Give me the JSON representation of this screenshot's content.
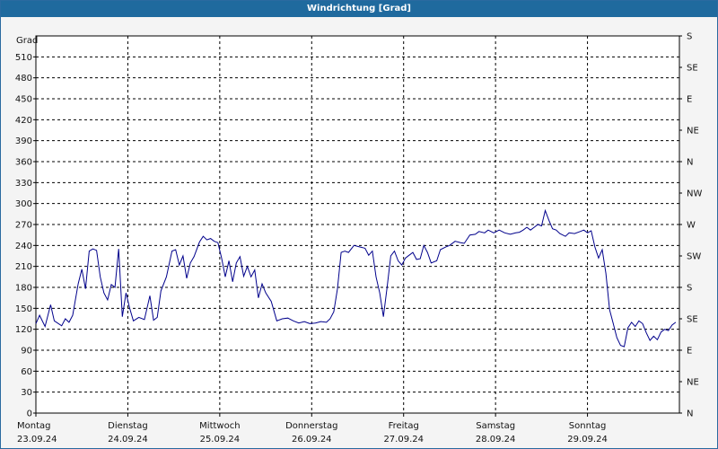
{
  "title": "Windrichtung [Grad]",
  "chart_data": {
    "type": "line",
    "title": "Windrichtung [Grad]",
    "ylabel": "Grad",
    "ylim": [
      0,
      540
    ],
    "yticks": [
      0,
      30,
      60,
      90,
      120,
      150,
      180,
      210,
      240,
      270,
      300,
      330,
      360,
      390,
      420,
      450,
      480,
      510
    ],
    "right_axis_labels": [
      "N",
      "NE",
      "E",
      "SE",
      "S",
      "SW",
      "W",
      "NW",
      "N",
      "NE",
      "E",
      "SE",
      "S"
    ],
    "right_axis_values": [
      0,
      45,
      90,
      135,
      180,
      225,
      270,
      315,
      360,
      405,
      450,
      495,
      540
    ],
    "days": [
      {
        "name": "Montag",
        "date": "23.09.24"
      },
      {
        "name": "Dienstag",
        "date": "24.09.24"
      },
      {
        "name": "Mittwoch",
        "date": "25.09.24"
      },
      {
        "name": "Donnerstag",
        "date": "26.09.24"
      },
      {
        "name": "Freitag",
        "date": "27.09.24"
      },
      {
        "name": "Samstag",
        "date": "28.09.24"
      },
      {
        "name": "Sonntag",
        "date": "29.09.24"
      }
    ],
    "x_unit": "days since Montag 23.09.24 00:00",
    "xlim": [
      0,
      7
    ],
    "grid": true,
    "line_color": "#00008b",
    "series": [
      {
        "name": "Windrichtung",
        "points": [
          [
            0.0,
            128
          ],
          [
            0.04,
            140
          ],
          [
            0.1,
            124
          ],
          [
            0.16,
            155
          ],
          [
            0.2,
            132
          ],
          [
            0.28,
            125
          ],
          [
            0.32,
            135
          ],
          [
            0.36,
            130
          ],
          [
            0.4,
            140
          ],
          [
            0.46,
            185
          ],
          [
            0.5,
            206
          ],
          [
            0.54,
            178
          ],
          [
            0.58,
            232
          ],
          [
            0.62,
            235
          ],
          [
            0.66,
            233
          ],
          [
            0.7,
            195
          ],
          [
            0.74,
            172
          ],
          [
            0.78,
            162
          ],
          [
            0.82,
            184
          ],
          [
            0.86,
            180
          ],
          [
            0.9,
            235
          ],
          [
            0.94,
            138
          ],
          [
            0.98,
            172
          ],
          [
            1.02,
            150
          ],
          [
            1.06,
            132
          ],
          [
            1.12,
            137
          ],
          [
            1.18,
            134
          ],
          [
            1.24,
            168
          ],
          [
            1.28,
            133
          ],
          [
            1.32,
            137
          ],
          [
            1.36,
            175
          ],
          [
            1.42,
            195
          ],
          [
            1.48,
            232
          ],
          [
            1.52,
            234
          ],
          [
            1.56,
            212
          ],
          [
            1.6,
            225
          ],
          [
            1.64,
            193
          ],
          [
            1.68,
            215
          ],
          [
            1.72,
            224
          ],
          [
            1.78,
            245
          ],
          [
            1.82,
            253
          ],
          [
            1.86,
            248
          ],
          [
            1.9,
            250
          ],
          [
            1.94,
            246
          ],
          [
            1.98,
            244
          ],
          [
            2.02,
            222
          ],
          [
            2.06,
            195
          ],
          [
            2.1,
            218
          ],
          [
            2.14,
            188
          ],
          [
            2.18,
            215
          ],
          [
            2.22,
            224
          ],
          [
            2.26,
            196
          ],
          [
            2.3,
            210
          ],
          [
            2.34,
            195
          ],
          [
            2.38,
            205
          ],
          [
            2.42,
            165
          ],
          [
            2.46,
            185
          ],
          [
            2.5,
            172
          ],
          [
            2.56,
            160
          ],
          [
            2.62,
            132
          ],
          [
            2.68,
            135
          ],
          [
            2.74,
            136
          ],
          [
            2.8,
            132
          ],
          [
            2.86,
            129
          ],
          [
            2.92,
            131
          ],
          [
            2.98,
            128
          ],
          [
            3.04,
            129
          ],
          [
            3.1,
            131
          ],
          [
            3.16,
            130
          ],
          [
            3.2,
            135
          ],
          [
            3.24,
            145
          ],
          [
            3.28,
            178
          ],
          [
            3.32,
            230
          ],
          [
            3.36,
            232
          ],
          [
            3.4,
            230
          ],
          [
            3.46,
            240
          ],
          [
            3.52,
            238
          ],
          [
            3.58,
            236
          ],
          [
            3.62,
            226
          ],
          [
            3.66,
            232
          ],
          [
            3.7,
            195
          ],
          [
            3.74,
            172
          ],
          [
            3.78,
            138
          ],
          [
            3.82,
            180
          ],
          [
            3.86,
            225
          ],
          [
            3.9,
            232
          ],
          [
            3.94,
            218
          ],
          [
            3.98,
            212
          ],
          [
            4.02,
            222
          ],
          [
            4.06,
            226
          ],
          [
            4.1,
            230
          ],
          [
            4.14,
            220
          ],
          [
            4.18,
            221
          ],
          [
            4.22,
            240
          ],
          [
            4.26,
            230
          ],
          [
            4.3,
            215
          ],
          [
            4.36,
            218
          ],
          [
            4.4,
            234
          ],
          [
            4.46,
            238
          ],
          [
            4.5,
            240
          ],
          [
            4.56,
            246
          ],
          [
            4.62,
            244
          ],
          [
            4.66,
            243
          ],
          [
            4.72,
            255
          ],
          [
            4.78,
            256
          ],
          [
            4.82,
            260
          ],
          [
            4.88,
            258
          ],
          [
            4.92,
            262
          ],
          [
            4.98,
            258
          ],
          [
            5.04,
            262
          ],
          [
            5.1,
            258
          ],
          [
            5.16,
            256
          ],
          [
            5.22,
            258
          ],
          [
            5.26,
            259
          ],
          [
            5.3,
            262
          ],
          [
            5.34,
            266
          ],
          [
            5.38,
            262
          ],
          [
            5.42,
            266
          ],
          [
            5.46,
            270
          ],
          [
            5.5,
            268
          ],
          [
            5.54,
            290
          ],
          [
            5.58,
            276
          ],
          [
            5.62,
            264
          ],
          [
            5.66,
            262
          ],
          [
            5.7,
            257
          ],
          [
            5.76,
            253
          ],
          [
            5.8,
            258
          ],
          [
            5.86,
            257
          ],
          [
            5.92,
            260
          ],
          [
            5.96,
            262
          ],
          [
            6.0,
            258
          ],
          [
            6.04,
            261
          ],
          [
            6.08,
            238
          ],
          [
            6.12,
            222
          ],
          [
            6.16,
            234
          ],
          [
            6.2,
            200
          ],
          [
            6.24,
            148
          ],
          [
            6.28,
            128
          ],
          [
            6.32,
            108
          ],
          [
            6.36,
            97
          ],
          [
            6.4,
            95
          ],
          [
            6.44,
            122
          ],
          [
            6.48,
            130
          ],
          [
            6.52,
            124
          ],
          [
            6.56,
            132
          ],
          [
            6.6,
            128
          ],
          [
            6.64,
            115
          ],
          [
            6.68,
            104
          ],
          [
            6.72,
            110
          ],
          [
            6.76,
            105
          ],
          [
            6.8,
            116
          ],
          [
            6.84,
            120
          ],
          [
            6.88,
            118
          ],
          [
            6.92,
            126
          ],
          [
            6.96,
            130
          ]
        ]
      }
    ]
  }
}
